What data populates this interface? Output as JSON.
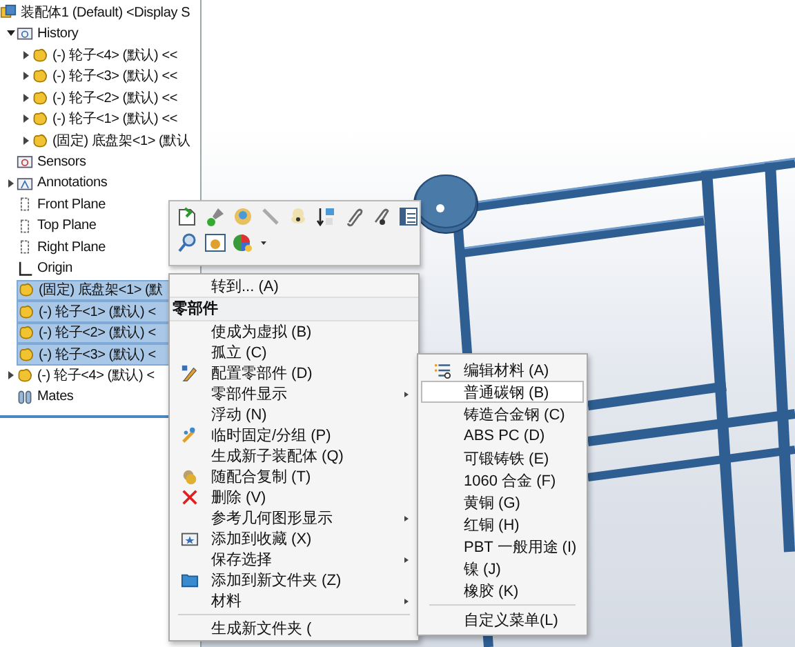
{
  "tree": {
    "root": {
      "label": "装配体1 (Default) <Display S",
      "kind": "assembly",
      "selected": false
    },
    "items": [
      {
        "label": "History",
        "kind": "history",
        "expanded": true,
        "selected": false,
        "children": [
          {
            "label": "(-) 轮子<4> (默认) <<",
            "kind": "part",
            "expanded": false,
            "selected": false
          },
          {
            "label": "(-) 轮子<3> (默认) <<",
            "kind": "part",
            "expanded": false,
            "selected": false
          },
          {
            "label": "(-) 轮子<2> (默认) <<",
            "kind": "part",
            "expanded": false,
            "selected": false
          },
          {
            "label": "(-) 轮子<1> (默认) <<",
            "kind": "part",
            "expanded": false,
            "selected": false
          },
          {
            "label": "(固定) 底盘架<1> (默认",
            "kind": "part",
            "expanded": false,
            "selected": false
          }
        ]
      },
      {
        "label": "Sensors",
        "kind": "sensors",
        "selected": false
      },
      {
        "label": "Annotations",
        "kind": "annotations",
        "expanded": false,
        "selected": false
      },
      {
        "label": "Front Plane",
        "kind": "plane",
        "selected": false
      },
      {
        "label": "Top Plane",
        "kind": "plane",
        "selected": false
      },
      {
        "label": "Right Plane",
        "kind": "plane",
        "selected": false
      },
      {
        "label": "Origin",
        "kind": "origin",
        "selected": false
      },
      {
        "label": "(固定) 底盘架<1> (默",
        "kind": "part",
        "expanded": false,
        "selected": true
      },
      {
        "label": "(-) 轮子<1> (默认) <",
        "kind": "part",
        "expanded": false,
        "selected": true
      },
      {
        "label": "(-) 轮子<2> (默认) <",
        "kind": "part",
        "expanded": false,
        "selected": true
      },
      {
        "label": "(-) 轮子<3> (默认) <",
        "kind": "part",
        "expanded": false,
        "selected": true
      },
      {
        "label": "(-) 轮子<4> (默认) <",
        "kind": "part",
        "expanded": false,
        "selected": false
      },
      {
        "label": "Mates",
        "kind": "mates",
        "selected": false
      }
    ]
  },
  "context_menu": {
    "items": [
      {
        "kind": "item",
        "label": "转到... (A)",
        "submenu": false
      },
      {
        "kind": "header",
        "label": "零部件"
      },
      {
        "kind": "item",
        "label": "使成为虚拟 (B)",
        "submenu": false
      },
      {
        "kind": "item",
        "label": "孤立 (C)",
        "submenu": false
      },
      {
        "kind": "item",
        "label": "配置零部件 (D)",
        "submenu": false
      },
      {
        "kind": "item",
        "label": "零部件显示",
        "submenu": true
      },
      {
        "kind": "item",
        "label": "浮动 (N)",
        "submenu": false
      },
      {
        "kind": "item",
        "label": "临时固定/分组 (P)",
        "submenu": false
      },
      {
        "kind": "item",
        "label": "生成新子装配体 (Q)",
        "submenu": false
      },
      {
        "kind": "item",
        "label": "随配合复制 (T)",
        "submenu": false
      },
      {
        "kind": "item",
        "label": "删除 (V)",
        "submenu": false
      },
      {
        "kind": "item",
        "label": "参考几何图形显示",
        "submenu": true
      },
      {
        "kind": "item",
        "label": "添加到收藏 (X)",
        "submenu": false
      },
      {
        "kind": "item",
        "label": "保存选择",
        "submenu": true
      },
      {
        "kind": "item",
        "label": "添加到新文件夹 (Z)",
        "submenu": false
      },
      {
        "kind": "item",
        "label": "材料",
        "submenu": true
      },
      {
        "kind": "separator"
      },
      {
        "kind": "item",
        "label": "生成新文件夹 (",
        "submenu": false
      }
    ]
  },
  "material_menu": {
    "items": [
      {
        "kind": "item",
        "label": "编辑材料 (A)",
        "selected": false
      },
      {
        "kind": "item",
        "label": "普通碳钢 (B)",
        "selected": true
      },
      {
        "kind": "item",
        "label": "铸造合金钢 (C)",
        "selected": false
      },
      {
        "kind": "item",
        "label": "ABS PC (D)",
        "selected": false
      },
      {
        "kind": "item",
        "label": "可锻铸铁 (E)",
        "selected": false
      },
      {
        "kind": "item",
        "label": "1060 合金 (F)",
        "selected": false
      },
      {
        "kind": "item",
        "label": "黄铜 (G)",
        "selected": false
      },
      {
        "kind": "item",
        "label": "红铜 (H)",
        "selected": false
      },
      {
        "kind": "item",
        "label": "PBT 一般用途 (I)",
        "selected": false
      },
      {
        "kind": "item",
        "label": "镍 (J)",
        "selected": false
      },
      {
        "kind": "item",
        "label": "橡胶 (K)",
        "selected": false
      },
      {
        "kind": "separator"
      },
      {
        "kind": "item",
        "label": "自定义菜单(L)",
        "selected": false
      }
    ]
  }
}
